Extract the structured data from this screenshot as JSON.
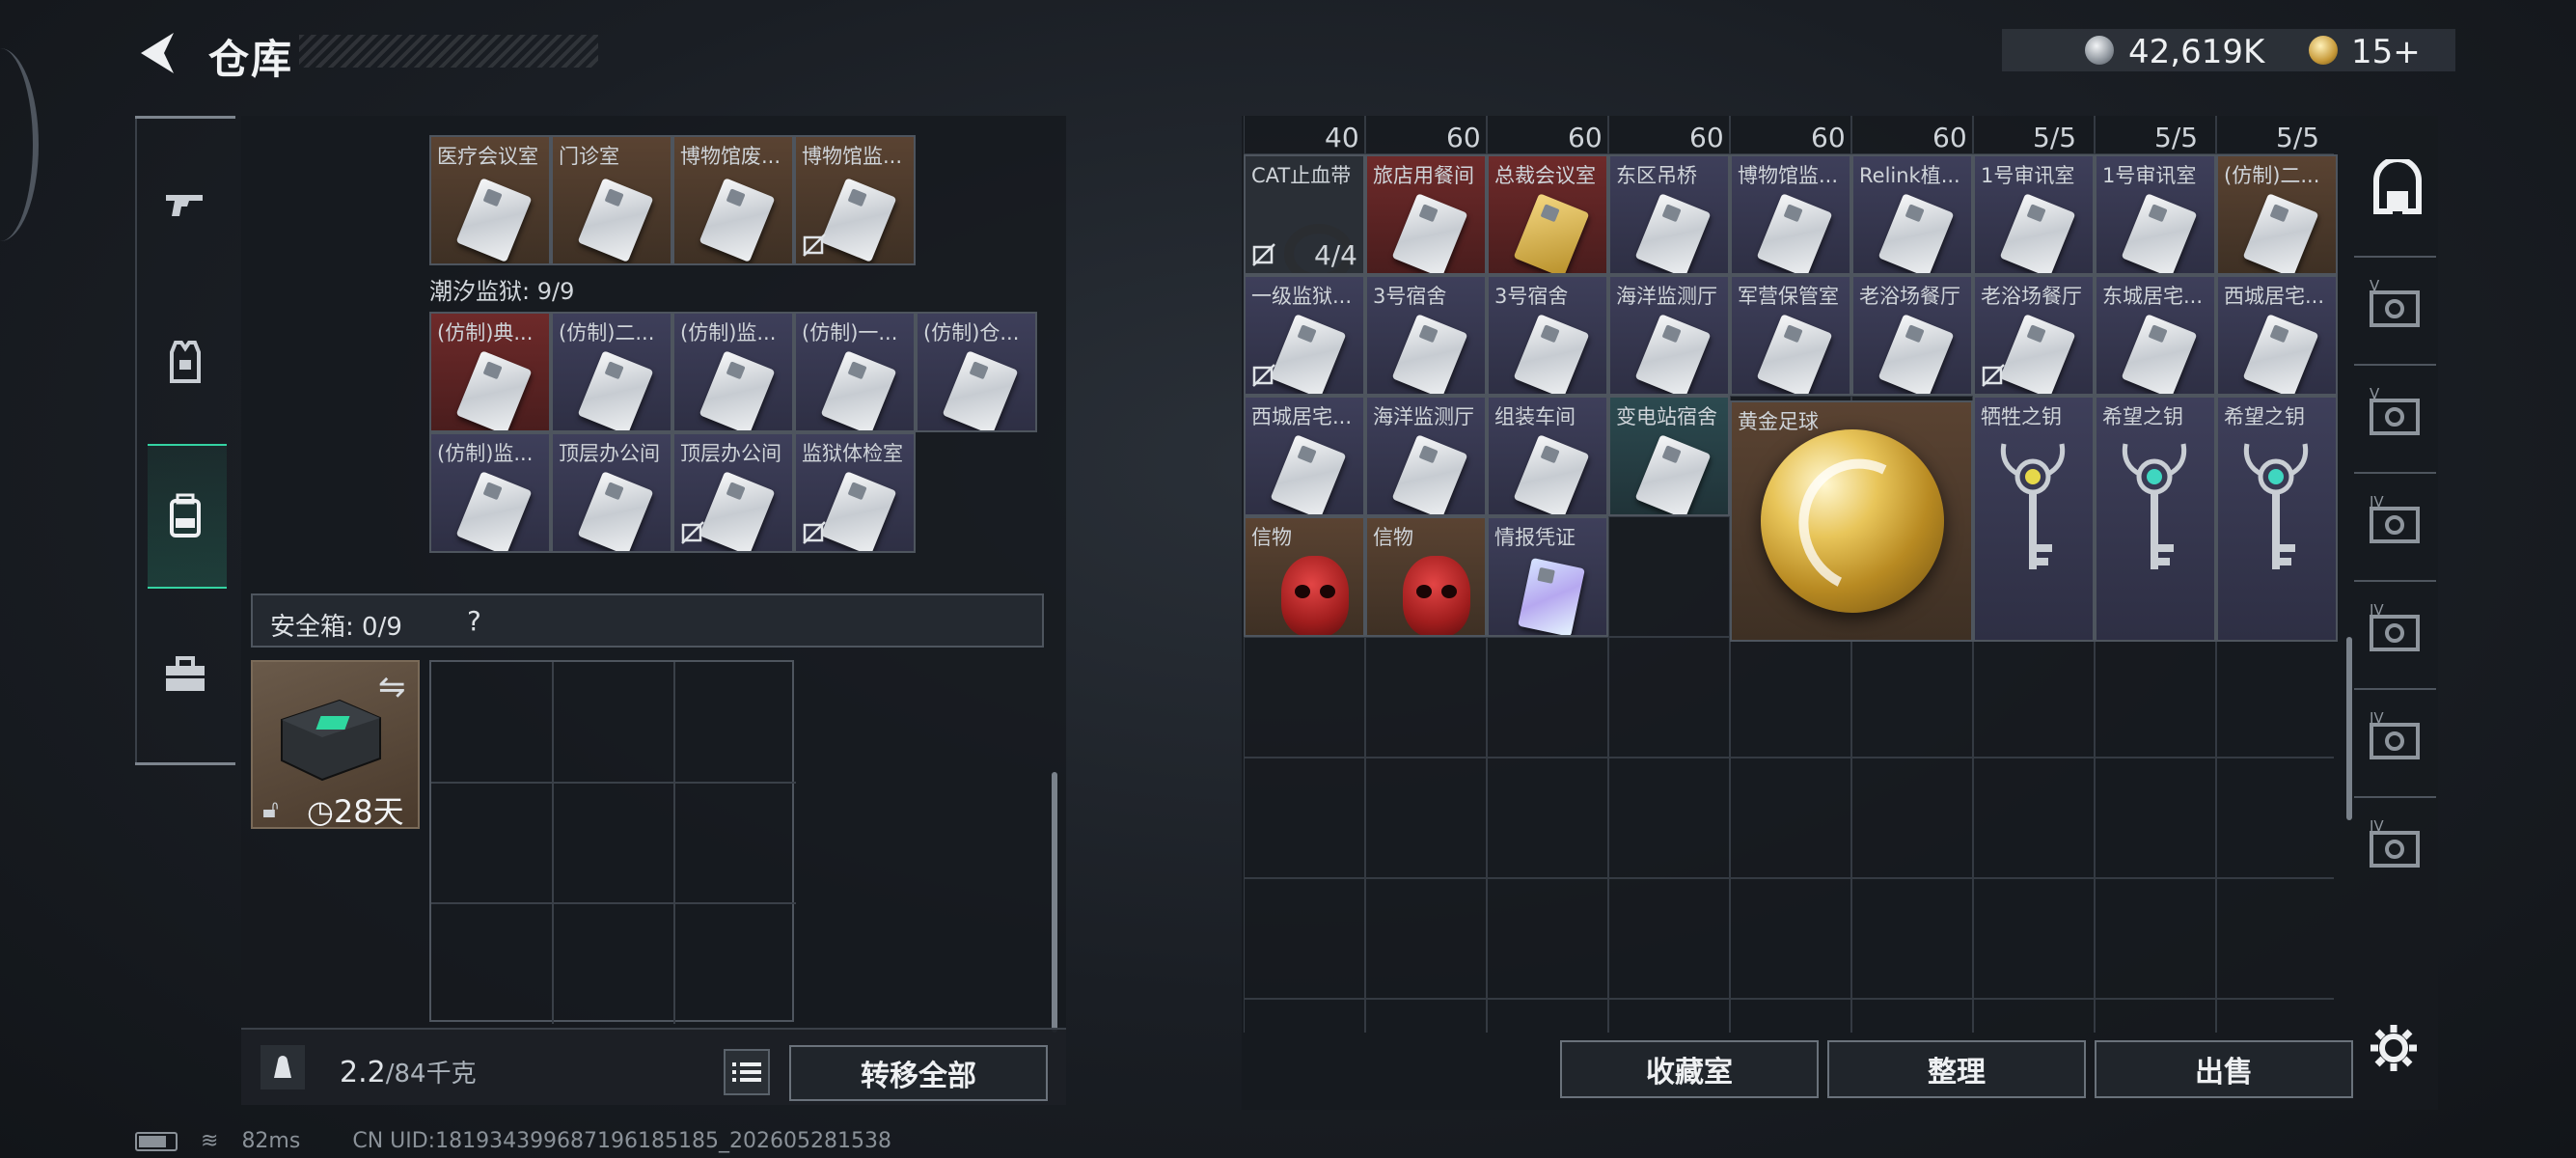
{
  "header": {
    "title": "仓库",
    "back_icon": "back-arrow-icon",
    "silver_amount": "42,619K",
    "gold_amount": "15+"
  },
  "nav": {
    "items": [
      {
        "name": "weapons",
        "icon": "gun-icon"
      },
      {
        "name": "armor",
        "icon": "vest-icon"
      },
      {
        "name": "backpack",
        "icon": "backpack-icon",
        "active": true
      },
      {
        "name": "case",
        "icon": "briefcase-icon"
      }
    ],
    "active_color": "#34d3a2"
  },
  "left": {
    "partial_row": [
      {
        "name": "医疗会议室",
        "bg": "brown"
      },
      {
        "name": "门诊室",
        "bg": "brown"
      },
      {
        "name": "博物馆废...",
        "bg": "brown"
      },
      {
        "name": "博物馆监...",
        "bg": "brown",
        "noedit": true
      }
    ],
    "section_title": "潮汐监狱: 9/9",
    "prison_rows": [
      [
        {
          "name": "(仿制)典...",
          "bg": "red"
        },
        {
          "name": "(仿制)二...",
          "bg": "purple"
        },
        {
          "name": "(仿制)监...",
          "bg": "purple"
        },
        {
          "name": "(仿制)一...",
          "bg": "purple"
        },
        {
          "name": "(仿制)仓...",
          "bg": "purple"
        }
      ],
      [
        {
          "name": "(仿制)监...",
          "bg": "purple"
        },
        {
          "name": "顶层办公间",
          "bg": "purple"
        },
        {
          "name": "顶层办公间",
          "bg": "purple",
          "noedit": true
        },
        {
          "name": "监狱体检室",
          "bg": "purple",
          "noedit": true
        }
      ]
    ],
    "safe_label": "安全箱: 0/9",
    "safe_help": "?",
    "safebox_timer": "28天",
    "weight_value": "2.2",
    "weight_max": "/84千克",
    "transfer_all": "转移全部"
  },
  "right": {
    "top_qty": [
      "40",
      "60",
      "60",
      "60",
      "60",
      "60",
      "5/5",
      "5/5",
      "5/5"
    ],
    "rows": [
      [
        {
          "name": "CAT止血带",
          "bg": "dark",
          "type": "tourniquet",
          "qty": "4/4",
          "noedit": true
        },
        {
          "name": "旅店用餐间",
          "bg": "red",
          "type": "card"
        },
        {
          "name": "总裁会议室",
          "bg": "red",
          "type": "goldcard"
        },
        {
          "name": "东区吊桥",
          "bg": "purple",
          "type": "card"
        },
        {
          "name": "博物馆监...",
          "bg": "purple",
          "type": "card"
        },
        {
          "name": "Relink植...",
          "bg": "purple",
          "type": "card"
        },
        {
          "name": "1号审讯室",
          "bg": "purple",
          "type": "card"
        },
        {
          "name": "1号审讯室",
          "bg": "purple",
          "type": "card"
        },
        {
          "name": "(仿制)二...",
          "bg": "brown",
          "type": "card"
        }
      ],
      [
        {
          "name": "一级监狱...",
          "bg": "purple",
          "type": "card",
          "noedit": true
        },
        {
          "name": "3号宿舍",
          "bg": "purple",
          "type": "card"
        },
        {
          "name": "3号宿舍",
          "bg": "purple",
          "type": "card"
        },
        {
          "name": "海洋监测厅",
          "bg": "purple",
          "type": "card"
        },
        {
          "name": "军营保管室",
          "bg": "purple",
          "type": "card"
        },
        {
          "name": "老浴场餐厅",
          "bg": "purple",
          "type": "card"
        },
        {
          "name": "老浴场餐厅",
          "bg": "purple",
          "type": "card",
          "noedit": true
        },
        {
          "name": "东城居宅...",
          "bg": "purple",
          "type": "card"
        },
        {
          "name": "西城居宅...",
          "bg": "purple",
          "type": "card"
        }
      ],
      [
        {
          "name": "西城居宅...",
          "bg": "purple",
          "type": "card"
        },
        {
          "name": "海洋监测厅",
          "bg": "purple",
          "type": "card"
        },
        {
          "name": "组装车间",
          "bg": "purple",
          "type": "card"
        },
        {
          "name": "变电站宿舍",
          "bg": "teal",
          "type": "card"
        }
      ],
      [
        {
          "name": "信物",
          "bg": "brown",
          "type": "mask"
        },
        {
          "name": "信物",
          "bg": "brown",
          "type": "mask"
        },
        {
          "name": "情报凭证",
          "bg": "purple",
          "type": "holocard"
        }
      ]
    ],
    "ball": {
      "name": "黄金足球"
    },
    "keys": [
      {
        "name": "牺牲之钥",
        "gem": "#e6d84a",
        "bg": "purple"
      },
      {
        "name": "希望之钥",
        "gem": "#3fd6c0",
        "bg": "purple"
      },
      {
        "name": "希望之钥",
        "gem": "#3fd6c0",
        "bg": "purple"
      }
    ],
    "buttons": [
      "收藏室",
      "整理",
      "出售"
    ],
    "rail": [
      {
        "icon": "tier-v-container-icon",
        "label": "V"
      },
      {
        "icon": "tier-v-container-icon",
        "label": "V"
      },
      {
        "icon": "tier-iv-container-icon",
        "label": "IV"
      },
      {
        "icon": "tier-iv-container-icon",
        "label": "IV"
      },
      {
        "icon": "tier-iv-container-icon",
        "label": "IV"
      },
      {
        "icon": "tier-iv-container-icon",
        "label": "IV"
      }
    ]
  },
  "status": {
    "ping": "82ms",
    "uid": "CN UID:181934399687196185185_202605281538"
  }
}
